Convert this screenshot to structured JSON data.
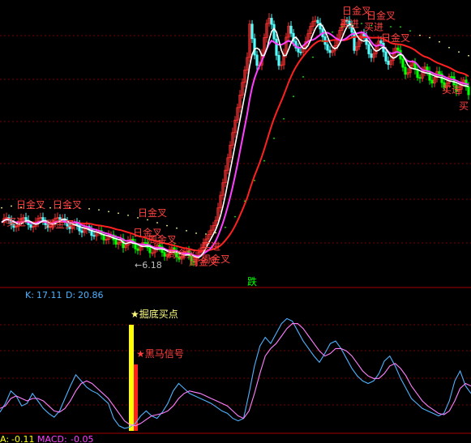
{
  "chart_data": [
    {
      "type": "candlestick",
      "panel": "price",
      "min_price_label": "6.18",
      "indicator_text": "跌",
      "signals": [
        {
          "text": "日金叉",
          "x": 6,
          "y": 9.3
        },
        {
          "text": "日金叉",
          "x": 21,
          "y": 9.3
        },
        {
          "text": "买进",
          "x": 2,
          "y": 8.45
        },
        {
          "text": "周金叉",
          "x": 18,
          "y": 8.35
        },
        {
          "text": "日金叉",
          "x": 56,
          "y": 8.9
        },
        {
          "text": "日金叉",
          "x": 54,
          "y": 7.92
        },
        {
          "text": "周金叉",
          "x": 60,
          "y": 7.58
        },
        {
          "text": "周金叉",
          "x": 68,
          "y": 6.88
        },
        {
          "text": "周金叉",
          "x": 77,
          "y": 6.48
        },
        {
          "text": "买进",
          "x": 82,
          "y": 7.25
        },
        {
          "text": "周金叉",
          "x": 82,
          "y": 6.62
        },
        {
          "text": "日金叉",
          "x": 140,
          "y": 18.9
        },
        {
          "text": "买进",
          "x": 139,
          "y": 18.25
        },
        {
          "text": "日金叉",
          "x": 150,
          "y": 18.65
        },
        {
          "text": "买进",
          "x": 149,
          "y": 18.1
        },
        {
          "text": "日金叉",
          "x": 156,
          "y": 17.55
        },
        {
          "text": "买进",
          "x": 181,
          "y": 15.0
        },
        {
          "text": "买",
          "x": 188,
          "y": 14.2
        }
      ]
    },
    {
      "type": "line",
      "panel": "kdj",
      "k_label": "K:",
      "k_value": "17.11",
      "d_label": "D:",
      "d_value": "20.86",
      "annotations": [
        "掘底买点",
        "黑马信号"
      ],
      "series": [
        {
          "name": "K",
          "values": [
            15,
            22,
            32,
            28,
            20,
            22,
            30,
            24,
            18,
            14,
            11,
            16,
            26,
            36,
            45,
            40,
            35,
            32,
            30,
            26,
            22,
            10,
            4,
            2,
            3,
            6,
            12,
            16,
            12,
            10,
            15,
            22,
            32,
            38,
            34,
            30,
            28,
            26,
            24,
            22,
            19,
            16,
            14,
            10,
            8,
            10,
            30,
            52,
            68,
            75,
            70,
            78,
            86,
            90,
            88,
            80,
            72,
            66,
            60,
            55,
            62,
            70,
            72,
            66,
            58,
            50,
            44,
            40,
            38,
            40,
            46,
            56,
            60,
            52,
            42,
            34,
            26,
            22,
            18,
            16,
            14,
            12,
            14,
            24,
            40,
            48,
            36,
            30
          ]
        },
        {
          "name": "D",
          "values": [
            18,
            20,
            26,
            28,
            26,
            24,
            26,
            26,
            24,
            20,
            16,
            15,
            18,
            24,
            32,
            38,
            40,
            38,
            34,
            30,
            26,
            20,
            14,
            8,
            5,
            4,
            6,
            9,
            12,
            13,
            14,
            16,
            20,
            26,
            30,
            32,
            31,
            30,
            28,
            26,
            24,
            22,
            20,
            16,
            12,
            10,
            16,
            30,
            46,
            60,
            66,
            70,
            76,
            82,
            86,
            86,
            82,
            76,
            70,
            64,
            60,
            62,
            66,
            66,
            64,
            60,
            54,
            48,
            44,
            42,
            42,
            46,
            52,
            54,
            50,
            44,
            36,
            30,
            24,
            20,
            17,
            14,
            13,
            16,
            24,
            34,
            38,
            36
          ]
        }
      ]
    }
  ],
  "footer": {
    "a_label": "A:",
    "a_value": "-0.11",
    "macd_label": "MACD:",
    "macd_value": "-0.05"
  },
  "colors": {
    "background": "#000000",
    "up": "#ff3232",
    "down": "#54fcfc",
    "ma_white": "#ffffff",
    "ma_magenta": "#ff40ff",
    "ma_red": "#ff2020",
    "signal_text": "#ff4040",
    "kdj_k": "#4fb3ff",
    "kdj_d": "#ff80ff",
    "separator": "#a00000",
    "grid": "#7a0000",
    "yellow": "#ffff00",
    "green_text": "#00ff00"
  }
}
